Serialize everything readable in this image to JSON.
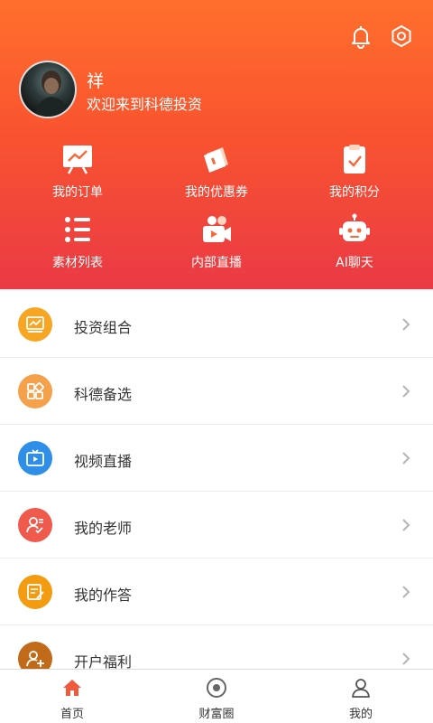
{
  "profile": {
    "name": "祥",
    "greeting": "欢迎来到科德投资"
  },
  "quick_links": [
    {
      "label": "我的订单",
      "icon": "order-chart-icon"
    },
    {
      "label": "我的优惠券",
      "icon": "coupon-ticket-icon"
    },
    {
      "label": "我的积分",
      "icon": "points-clipboard-icon"
    },
    {
      "label": "素材列表",
      "icon": "list-icon"
    },
    {
      "label": "内部直播",
      "icon": "video-camera-icon"
    },
    {
      "label": "AI聊天",
      "icon": "robot-icon"
    }
  ],
  "menu": [
    {
      "label": "投资组合",
      "icon": "portfolio-icon",
      "color": "#f6a623"
    },
    {
      "label": "科德备选",
      "icon": "grid-icon",
      "color": "#f5a04a"
    },
    {
      "label": "视频直播",
      "icon": "tv-play-icon",
      "color": "#2f8ee8"
    },
    {
      "label": "我的老师",
      "icon": "teacher-icon",
      "color": "#ef5a4c"
    },
    {
      "label": "我的作答",
      "icon": "answer-icon",
      "color": "#f39c12"
    },
    {
      "label": "开户福利",
      "icon": "account-benefit-icon",
      "color": "#c06a1a"
    }
  ],
  "tabbar": [
    {
      "label": "首页",
      "icon": "home-icon",
      "active": true
    },
    {
      "label": "财富圈",
      "icon": "circle-icon",
      "active": false
    },
    {
      "label": "我的",
      "icon": "user-icon",
      "active": false
    }
  ],
  "colors": {
    "header_top": "#ff6f2c",
    "header_bottom": "#ea3a45",
    "tab_active": "#f05a3c"
  }
}
